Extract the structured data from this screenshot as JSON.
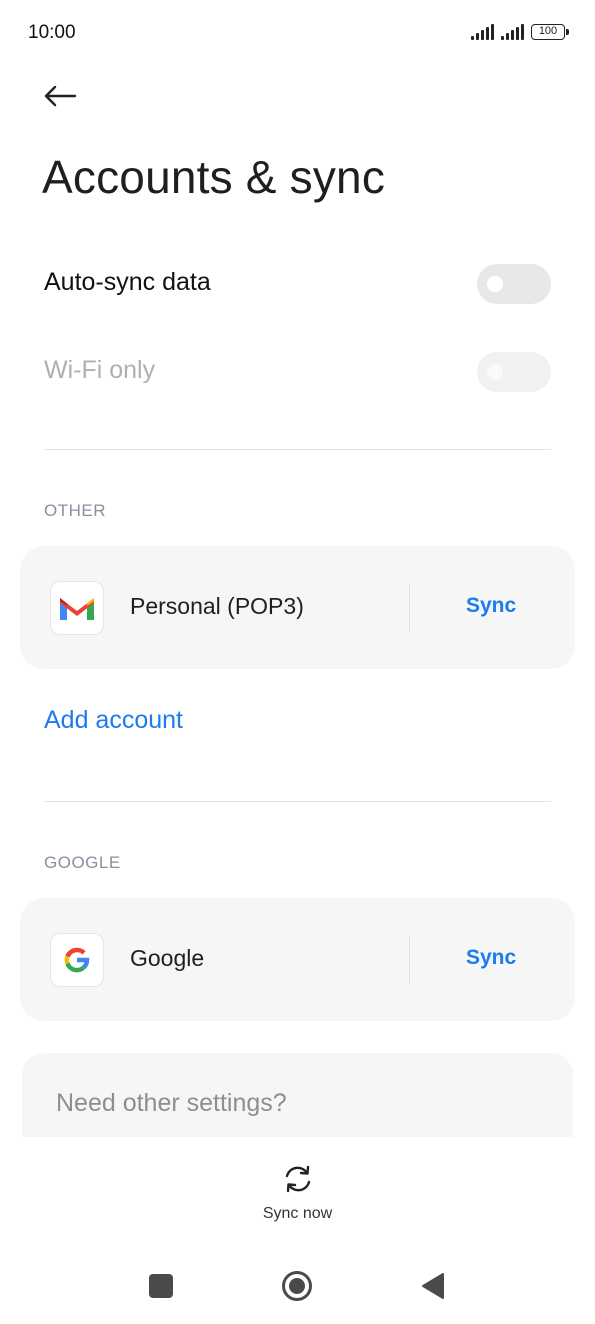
{
  "status_bar": {
    "time": "10:00",
    "battery": "100"
  },
  "header": {
    "title": "Accounts & sync"
  },
  "settings": {
    "auto_sync_label": "Auto-sync data",
    "wifi_only_label": "Wi-Fi only"
  },
  "sections": {
    "other": {
      "header": "OTHER",
      "account_name": "Personal (POP3)",
      "sync_label": "Sync",
      "icon": "gmail-icon"
    },
    "add_account_label": "Add account",
    "google": {
      "header": "GOOGLE",
      "account_name": "Google",
      "sync_label": "Sync",
      "icon": "google-icon"
    }
  },
  "more_settings_label": "Need other settings?",
  "footer": {
    "sync_now_label": "Sync now"
  },
  "colors": {
    "accent": "#1b7cf0",
    "card": "#f6f6f6",
    "section_header": "#8a8fa0"
  }
}
